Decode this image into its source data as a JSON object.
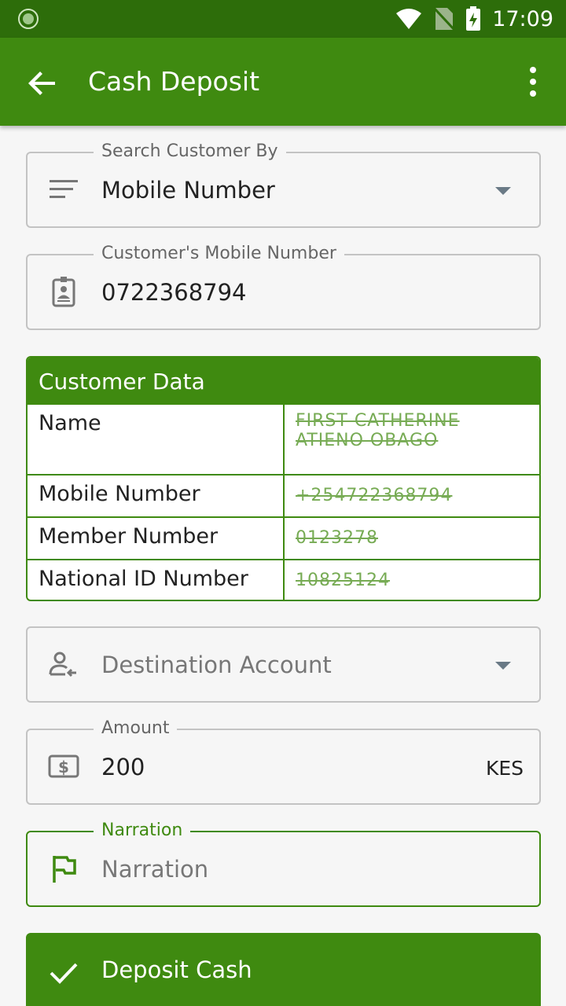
{
  "status_bar": {
    "time": "17:09"
  },
  "app_bar": {
    "title": "Cash Deposit",
    "back_icon": "arrow-back-icon",
    "menu_icon": "more-vert-icon"
  },
  "search_by": {
    "label": "Search Customer By",
    "value": "Mobile Number",
    "icon": "filter-list-icon"
  },
  "mobile": {
    "label": "Customer's Mobile Number",
    "value": "0722368794",
    "icon": "id-badge-icon"
  },
  "customer_data": {
    "title": "Customer Data",
    "rows": [
      {
        "key": "Name",
        "value": "FIRST CATHERINE ATIENO OBAGO"
      },
      {
        "key": "Mobile Number",
        "value": "+254722368794"
      },
      {
        "key": "Member Number",
        "value": "0123278"
      },
      {
        "key": "National ID Number",
        "value": "10825124"
      }
    ]
  },
  "destination": {
    "placeholder": "Destination Account",
    "icon": "person-transfer-icon"
  },
  "amount": {
    "label": "Amount",
    "value": "200",
    "currency": "KES",
    "icon": "dollar-bill-icon"
  },
  "narration": {
    "label": "Narration",
    "placeholder": "Narration",
    "icon": "flag-icon"
  },
  "deposit_button": {
    "label": "Deposit Cash",
    "icon": "check-icon"
  },
  "colors": {
    "primary": "#3f8a10",
    "status_bar": "#2d6d0a"
  }
}
